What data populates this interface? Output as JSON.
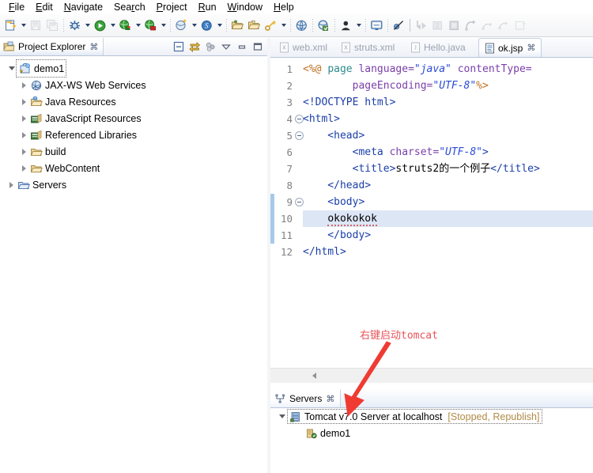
{
  "menubar": {
    "items": [
      {
        "label": "File",
        "mn": "F"
      },
      {
        "label": "Edit",
        "mn": "E"
      },
      {
        "label": "Navigate",
        "mn": "N"
      },
      {
        "label": "Search",
        "mn": "r"
      },
      {
        "label": "Project",
        "mn": "P"
      },
      {
        "label": "Run",
        "mn": "R"
      },
      {
        "label": "Window",
        "mn": "W"
      },
      {
        "label": "Help",
        "mn": "H"
      }
    ]
  },
  "toolbar": {
    "items": [
      {
        "name": "new-wizard-button",
        "icon": "new-file-icon",
        "enabled": true,
        "dropdown": true
      },
      {
        "name": "save-button",
        "icon": "save-icon",
        "enabled": false,
        "dropdown": false
      },
      {
        "name": "save-all-button",
        "icon": "save-all-icon",
        "enabled": false,
        "dropdown": false
      },
      {
        "name": "separator-1",
        "icon": "separator",
        "enabled": true,
        "dropdown": false
      },
      {
        "name": "debug-button",
        "icon": "debug-bug-icon",
        "enabled": true,
        "dropdown": true
      },
      {
        "name": "run-button",
        "icon": "run-green-play-icon",
        "enabled": true,
        "dropdown": true
      },
      {
        "name": "run-external-tools-button",
        "icon": "run-globe-green-icon",
        "enabled": true,
        "dropdown": true
      },
      {
        "name": "profile-button",
        "icon": "profile-globe-red-icon",
        "enabled": true,
        "dropdown": true
      },
      {
        "name": "separator-2",
        "icon": "separator",
        "enabled": true,
        "dropdown": false
      },
      {
        "name": "new-java-class-button",
        "icon": "new-class-icon",
        "enabled": true,
        "dropdown": true
      },
      {
        "name": "new-spring-bean-button",
        "icon": "blue-s-icon",
        "enabled": true,
        "dropdown": true
      },
      {
        "name": "separator-3",
        "icon": "separator",
        "enabled": true,
        "dropdown": false
      },
      {
        "name": "open-type-button",
        "icon": "open-folder-icon",
        "enabled": true,
        "dropdown": false
      },
      {
        "name": "open-resource-button",
        "icon": "open-folder-2-icon",
        "enabled": true,
        "dropdown": false
      },
      {
        "name": "new-key-button",
        "icon": "key-icon",
        "enabled": true,
        "dropdown": true
      },
      {
        "name": "separator-4",
        "icon": "separator",
        "enabled": true,
        "dropdown": false
      },
      {
        "name": "web-browser-button",
        "icon": "globe-icon",
        "enabled": true,
        "dropdown": false
      },
      {
        "name": "separator-5",
        "icon": "separator",
        "enabled": true,
        "dropdown": false
      },
      {
        "name": "search-button",
        "icon": "search-globe-icon",
        "enabled": true,
        "dropdown": false
      },
      {
        "name": "separator-6",
        "icon": "separator",
        "enabled": true,
        "dropdown": false
      },
      {
        "name": "user-button",
        "icon": "person-icon",
        "enabled": true,
        "dropdown": true
      },
      {
        "name": "separator-7",
        "icon": "separator",
        "enabled": true,
        "dropdown": false
      },
      {
        "name": "console-button",
        "icon": "console-icon",
        "enabled": true,
        "dropdown": false
      },
      {
        "name": "separator-8",
        "icon": "separator",
        "enabled": true,
        "dropdown": false
      },
      {
        "name": "skip-breakpoints-button",
        "icon": "breakpoint-skip-icon",
        "enabled": true,
        "dropdown": false
      },
      {
        "name": "separator-9",
        "icon": "separator-solid",
        "enabled": true,
        "dropdown": false
      },
      {
        "name": "step-into-button",
        "icon": "step-into-icon",
        "enabled": false,
        "dropdown": false
      },
      {
        "name": "step-over-button",
        "icon": "step-over-icon",
        "enabled": false,
        "dropdown": false
      },
      {
        "name": "terminate-button",
        "icon": "terminate-icon",
        "enabled": false,
        "dropdown": false
      },
      {
        "name": "step-return-button",
        "icon": "step-return-icon",
        "enabled": false,
        "dropdown": false
      },
      {
        "name": "disconnect-button",
        "icon": "disconnect-icon",
        "enabled": false,
        "dropdown": false
      },
      {
        "name": "resume-button",
        "icon": "resume-icon",
        "enabled": false,
        "dropdown": false
      },
      {
        "name": "suspend-button",
        "icon": "suspend-icon",
        "enabled": false,
        "dropdown": false
      }
    ]
  },
  "explorer": {
    "tab": {
      "title": "Project Explorer",
      "icon": "project-explorer-icon",
      "close": "⌘"
    },
    "tools": [
      {
        "name": "collapse-all-button",
        "icon": "collapse-all-icon"
      },
      {
        "name": "link-with-editor-button",
        "icon": "link-editor-icon"
      },
      {
        "name": "view-menu-button",
        "icon": "view-menu-icon"
      },
      {
        "name": "minimize-button",
        "icon": "minimize-icon"
      },
      {
        "name": "maximize-button",
        "icon": "maximize-icon"
      }
    ],
    "tree": [
      {
        "label": "demo1",
        "icon": "java-web-project-icon",
        "indent": 0,
        "state": "open",
        "selected": true
      },
      {
        "label": "JAX-WS Web Services",
        "icon": "jaxws-icon",
        "indent": 1,
        "state": "closed",
        "selected": false
      },
      {
        "label": "Java Resources",
        "icon": "java-resources-icon",
        "indent": 1,
        "state": "closed",
        "selected": false
      },
      {
        "label": "JavaScript Resources",
        "icon": "js-resources-icon",
        "indent": 1,
        "state": "closed",
        "selected": false
      },
      {
        "label": "Referenced Libraries",
        "icon": "referenced-libraries-icon",
        "indent": 1,
        "state": "closed",
        "selected": false
      },
      {
        "label": "build",
        "icon": "folder-icon",
        "indent": 1,
        "state": "closed",
        "selected": false
      },
      {
        "label": "WebContent",
        "icon": "folder-icon",
        "indent": 1,
        "state": "closed",
        "selected": false
      },
      {
        "label": "Servers",
        "icon": "servers-folder-icon",
        "indent": 0,
        "state": "closed",
        "selected": false
      }
    ]
  },
  "editor": {
    "tabs": [
      {
        "label": "web.xml",
        "icon": "xml-file-icon",
        "active": false,
        "closable": false
      },
      {
        "label": "struts.xml",
        "icon": "xml-file-icon",
        "active": false,
        "closable": false
      },
      {
        "label": "Hello.java",
        "icon": "java-file-icon",
        "active": false,
        "closable": false
      },
      {
        "label": "ok.jsp",
        "icon": "jsp-file-icon",
        "active": true,
        "closable": true,
        "close": "⌘"
      }
    ],
    "lines": [
      {
        "num": "1",
        "fold": false,
        "changed": false,
        "highlight": false,
        "tokens": [
          {
            "t": "<%@ ",
            "c": "k-dir"
          },
          {
            "t": "page",
            "c": "k-name"
          },
          {
            "t": " ",
            "c": "k-txt"
          },
          {
            "t": "language=",
            "c": "k-attr"
          },
          {
            "t": "\"java\"",
            "c": "k-str"
          },
          {
            "t": " ",
            "c": "k-txt"
          },
          {
            "t": "contentType=",
            "c": "k-attr"
          }
        ]
      },
      {
        "num": "2",
        "fold": false,
        "changed": false,
        "highlight": false,
        "tokens": [
          {
            "t": "        ",
            "c": "k-txt"
          },
          {
            "t": "pageEncoding=",
            "c": "k-attr"
          },
          {
            "t": "\"UTF-8\"",
            "c": "k-str"
          },
          {
            "t": "%>",
            "c": "k-dir"
          }
        ]
      },
      {
        "num": "3",
        "fold": false,
        "changed": false,
        "highlight": false,
        "tokens": [
          {
            "t": "<!DOCTYPE html>",
            "c": "k-doctype"
          }
        ]
      },
      {
        "num": "4",
        "fold": true,
        "changed": false,
        "highlight": false,
        "tokens": [
          {
            "t": "<html>",
            "c": "k-tag"
          }
        ]
      },
      {
        "num": "5",
        "fold": true,
        "changed": false,
        "highlight": false,
        "tokens": [
          {
            "t": "    <head>",
            "c": "k-tag"
          }
        ]
      },
      {
        "num": "6",
        "fold": false,
        "changed": false,
        "highlight": false,
        "tokens": [
          {
            "t": "        <meta ",
            "c": "k-tag"
          },
          {
            "t": "charset=",
            "c": "k-attr"
          },
          {
            "t": "\"UTF-8\"",
            "c": "k-str"
          },
          {
            "t": ">",
            "c": "k-tag"
          }
        ]
      },
      {
        "num": "7",
        "fold": false,
        "changed": false,
        "highlight": false,
        "tokens": [
          {
            "t": "        <title>",
            "c": "k-tag"
          },
          {
            "t": "struts2的一个例子",
            "c": "k-txt"
          },
          {
            "t": "</title>",
            "c": "k-tag"
          }
        ]
      },
      {
        "num": "8",
        "fold": false,
        "changed": false,
        "highlight": false,
        "tokens": [
          {
            "t": "    </head>",
            "c": "k-tag"
          }
        ]
      },
      {
        "num": "9",
        "fold": true,
        "changed": true,
        "highlight": false,
        "tokens": [
          {
            "t": "    <body>",
            "c": "k-tag"
          }
        ]
      },
      {
        "num": "10",
        "fold": false,
        "changed": true,
        "highlight": true,
        "tokens": [
          {
            "t": "    ",
            "c": "k-txt"
          },
          {
            "t": "okokokok",
            "c": "k-txt spell"
          }
        ]
      },
      {
        "num": "11",
        "fold": false,
        "changed": true,
        "highlight": false,
        "tokens": [
          {
            "t": "    </body>",
            "c": "k-tag"
          }
        ]
      },
      {
        "num": "12",
        "fold": false,
        "changed": false,
        "highlight": false,
        "tokens": [
          {
            "t": "</html>",
            "c": "k-tag"
          }
        ]
      }
    ]
  },
  "servers": {
    "tab": {
      "title": "Servers",
      "icon": "servers-view-icon",
      "close": "⌘"
    },
    "rows": [
      {
        "label": "Tomcat v7.0 Server at localhost",
        "status": "[Stopped, Republish]",
        "icon": "tomcat-server-icon",
        "indent": 0,
        "state": "open",
        "selected": true
      },
      {
        "label": "demo1",
        "status": "",
        "icon": "module-icon",
        "indent": 1,
        "state": "none",
        "selected": false
      }
    ]
  },
  "annotation": {
    "text": "右键启动tomcat",
    "color": "#e8545a",
    "arrow_name": "red-arrow-annotation"
  },
  "colors": {
    "accent": "#3b6ea5",
    "selection": "#dde6f5",
    "change_bar": "#a8c8e8",
    "status_text": "#b08a46",
    "annotation_red": "#e8545a"
  }
}
